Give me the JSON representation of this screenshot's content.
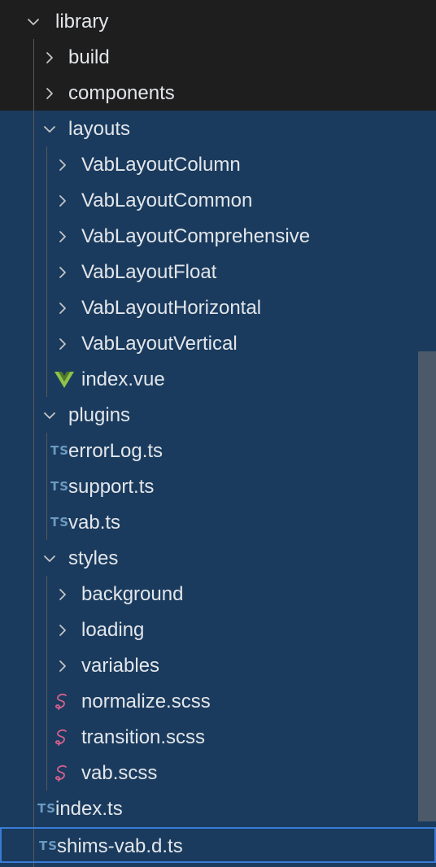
{
  "explorer": {
    "items": [
      {
        "label": "library",
        "type": "folder",
        "expanded": true,
        "depth": 0,
        "name": "tree-folder-library"
      },
      {
        "label": "build",
        "type": "folder",
        "expanded": false,
        "depth": 1,
        "name": "tree-folder-build"
      },
      {
        "label": "components",
        "type": "folder",
        "expanded": false,
        "depth": 1,
        "name": "tree-folder-components"
      },
      {
        "label": "layouts",
        "type": "folder",
        "expanded": true,
        "depth": 1,
        "name": "tree-folder-layouts"
      },
      {
        "label": "VabLayoutColumn",
        "type": "folder",
        "expanded": false,
        "depth": 2,
        "name": "tree-folder-vablayoutcolumn"
      },
      {
        "label": "VabLayoutCommon",
        "type": "folder",
        "expanded": false,
        "depth": 2,
        "name": "tree-folder-vablayoutcommon"
      },
      {
        "label": "VabLayoutComprehensive",
        "type": "folder",
        "expanded": false,
        "depth": 2,
        "name": "tree-folder-vablayoutcomprehensive"
      },
      {
        "label": "VabLayoutFloat",
        "type": "folder",
        "expanded": false,
        "depth": 2,
        "name": "tree-folder-vablayoutfloat"
      },
      {
        "label": "VabLayoutHorizontal",
        "type": "folder",
        "expanded": false,
        "depth": 2,
        "name": "tree-folder-vablayouthorizontal"
      },
      {
        "label": "VabLayoutVertical",
        "type": "folder",
        "expanded": false,
        "depth": 2,
        "name": "tree-folder-vablayoutvertical"
      },
      {
        "label": "index.vue",
        "type": "vue",
        "depth": 2,
        "name": "tree-file-index-vue"
      },
      {
        "label": "plugins",
        "type": "folder",
        "expanded": true,
        "depth": 1,
        "name": "tree-folder-plugins"
      },
      {
        "label": "errorLog.ts",
        "type": "ts",
        "depth": 1,
        "name": "tree-file-errorlog-ts"
      },
      {
        "label": "support.ts",
        "type": "ts",
        "depth": 1,
        "name": "tree-file-support-ts"
      },
      {
        "label": "vab.ts",
        "type": "ts",
        "depth": 1,
        "name": "tree-file-vab-ts"
      },
      {
        "label": "styles",
        "type": "folder",
        "expanded": true,
        "depth": 1,
        "name": "tree-folder-styles"
      },
      {
        "label": "background",
        "type": "folder",
        "expanded": false,
        "depth": 2,
        "name": "tree-folder-background"
      },
      {
        "label": "loading",
        "type": "folder",
        "expanded": false,
        "depth": 2,
        "name": "tree-folder-loading"
      },
      {
        "label": "variables",
        "type": "folder",
        "expanded": false,
        "depth": 2,
        "name": "tree-folder-variables"
      },
      {
        "label": "normalize.scss",
        "type": "scss",
        "depth": 2,
        "name": "tree-file-normalize-scss"
      },
      {
        "label": "transition.scss",
        "type": "scss",
        "depth": 2,
        "name": "tree-file-transition-scss"
      },
      {
        "label": "vab.scss",
        "type": "scss",
        "depth": 2,
        "name": "tree-file-vab-scss"
      },
      {
        "label": "index.ts",
        "type": "ts",
        "depth": 0,
        "name": "tree-file-index-ts"
      },
      {
        "label": "shims-vab.d.ts",
        "type": "ts",
        "depth": 0,
        "focused": true,
        "name": "tree-file-shims-vab-d-ts"
      }
    ],
    "ts_badge": "TS",
    "colors": {
      "background": "#1e1e1e",
      "selection": "#1a3b5e",
      "focus_border": "#3a7bd5",
      "text": "#e3e6ea",
      "ts_icon": "#6c9ac0",
      "vue_icon": "#8dc149",
      "scss_icon": "#d4608c",
      "chevron": "#c5c5c5"
    }
  }
}
